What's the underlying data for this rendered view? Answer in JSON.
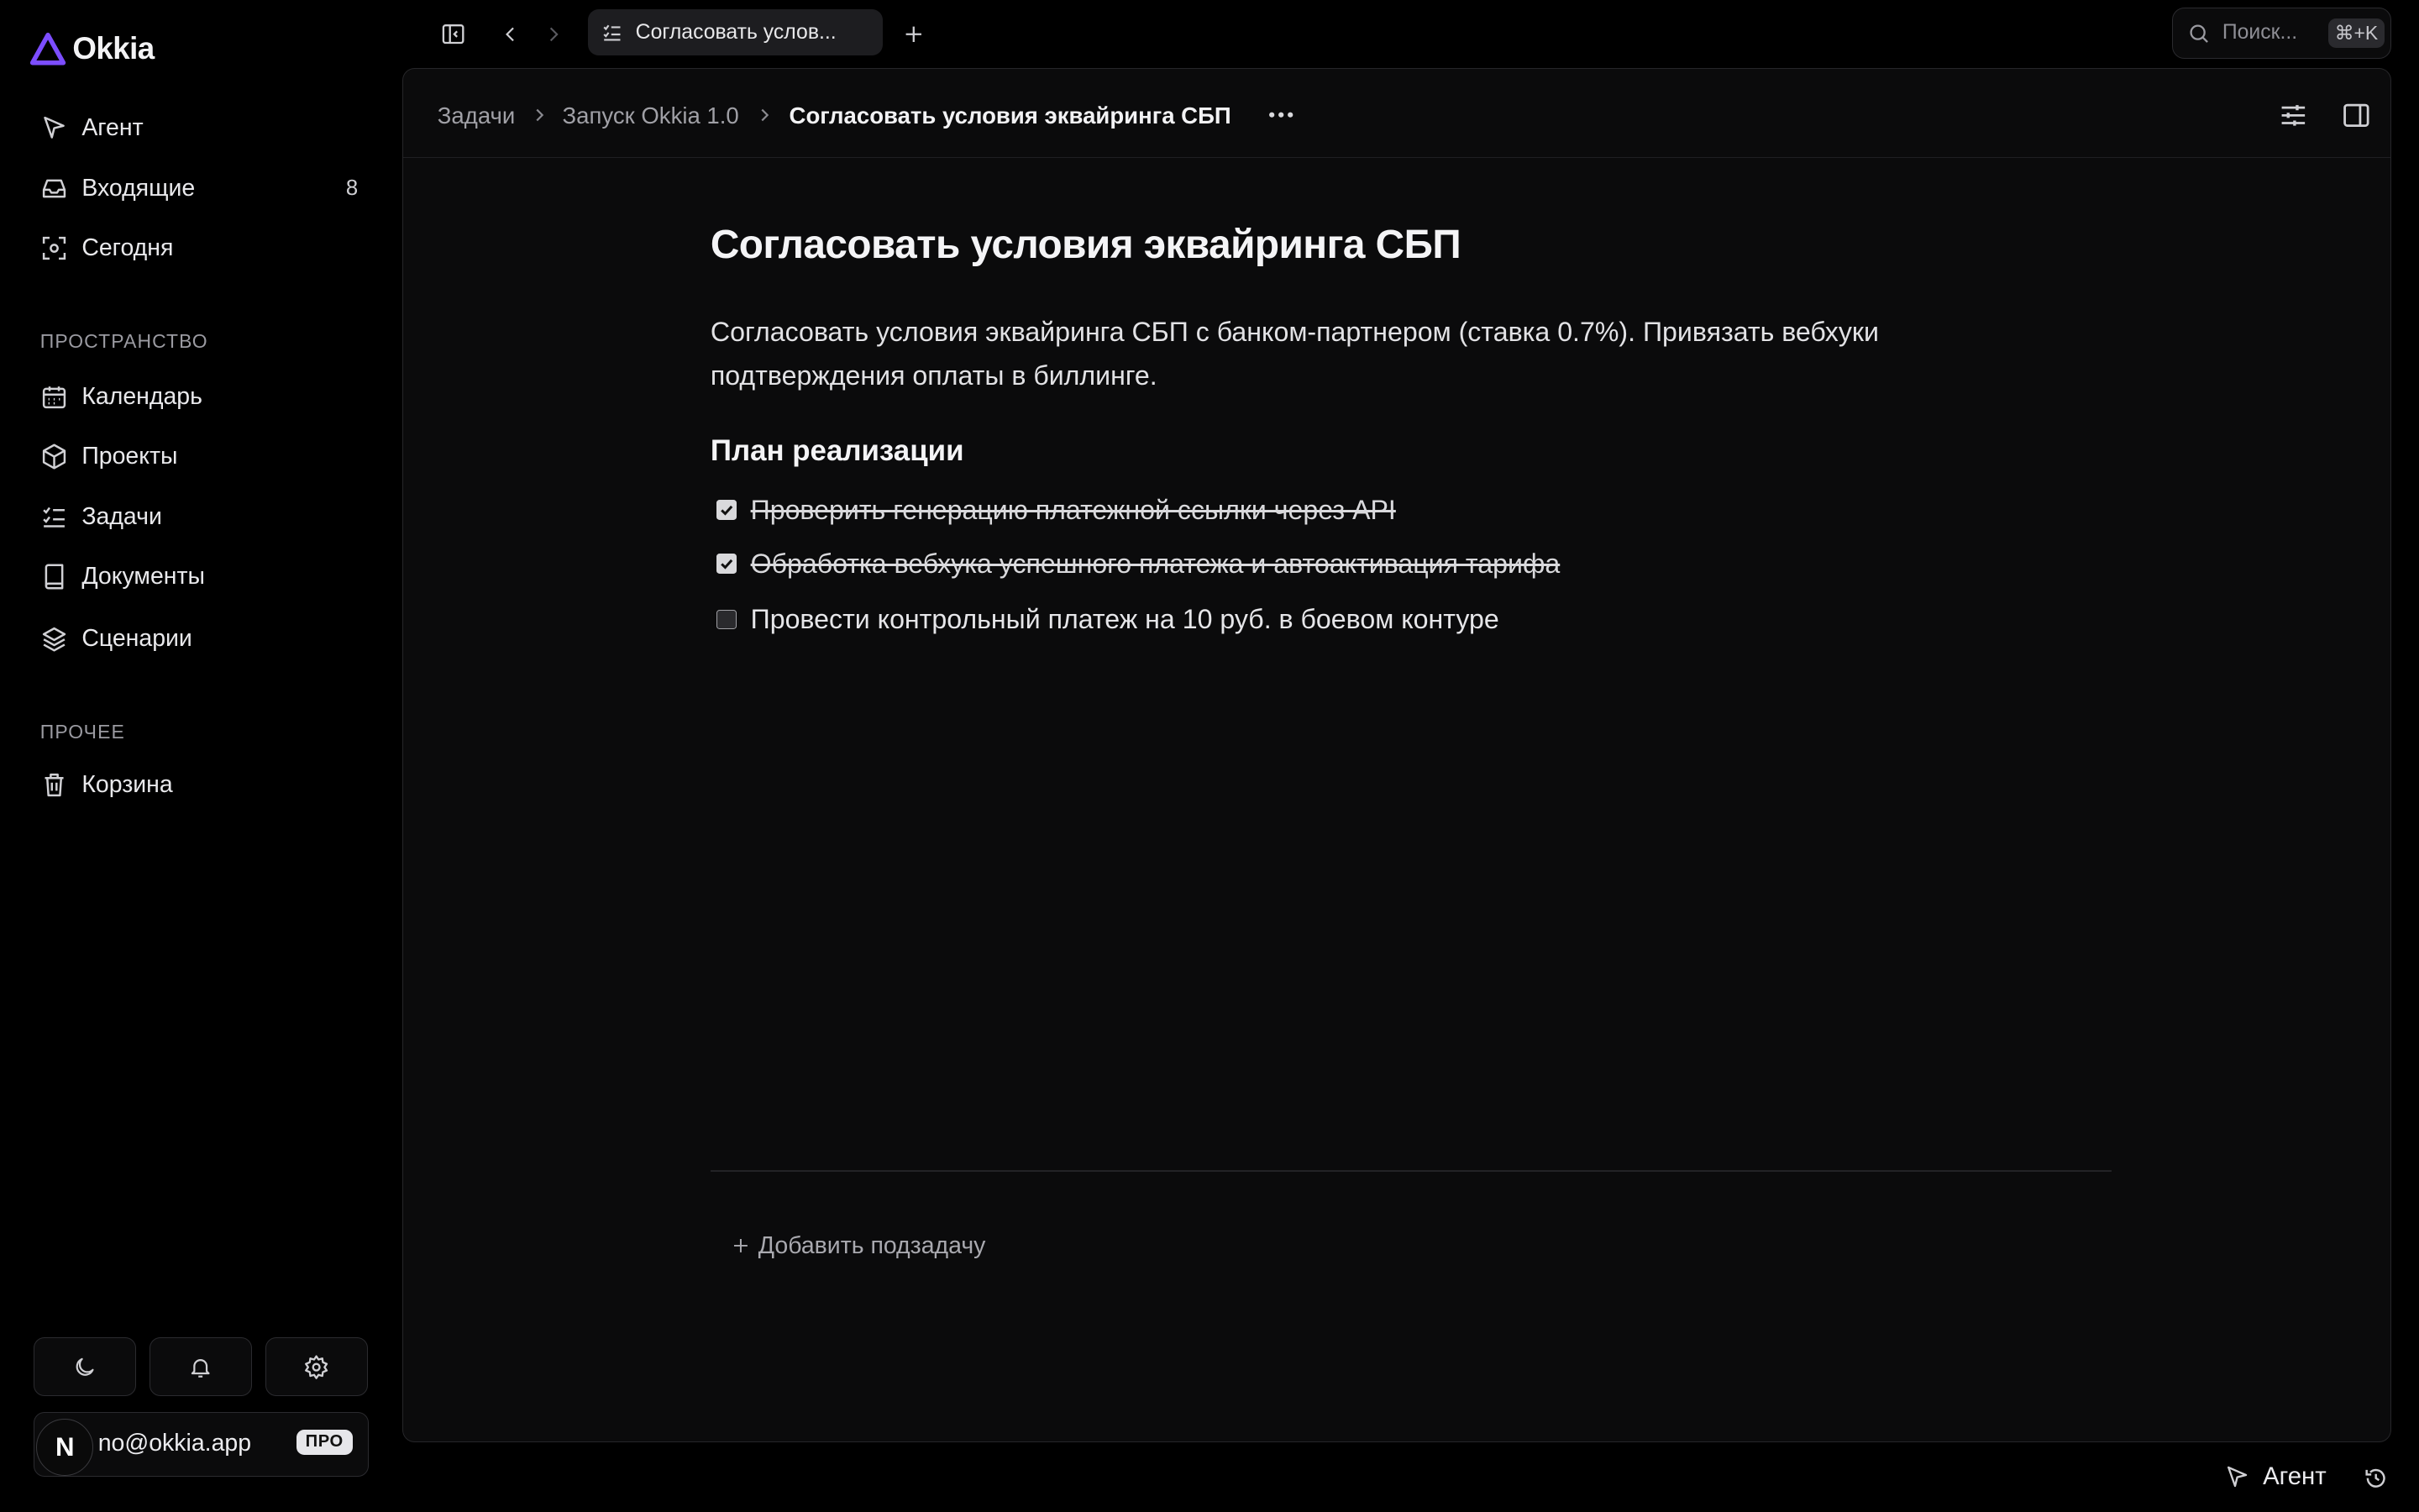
{
  "app": {
    "name": "Okkia",
    "brand_color": "#7c4dff"
  },
  "sidebar": {
    "nav": [
      {
        "label": "Агент",
        "icon": "cursor-icon"
      },
      {
        "label": "Входящие",
        "icon": "inbox-icon",
        "count": "8"
      },
      {
        "label": "Сегодня",
        "icon": "focus-icon"
      }
    ],
    "space_label": "ПРОСТРАНСТВО",
    "space": [
      {
        "label": "Календарь",
        "icon": "calendar-icon"
      },
      {
        "label": "Проекты",
        "icon": "box-icon"
      },
      {
        "label": "Задачи",
        "icon": "checklist-icon"
      },
      {
        "label": "Документы",
        "icon": "book-icon"
      },
      {
        "label": "Сценарии",
        "icon": "layers-icon"
      }
    ],
    "other_label": "ПРОЧЕЕ",
    "other": [
      {
        "label": "Корзина",
        "icon": "trash-icon"
      }
    ],
    "user": {
      "avatar_letter": "N",
      "email": "no@okkia.app",
      "plan": "ПРО"
    }
  },
  "topbar": {
    "tab_title": "Согласовать услов...",
    "search_placeholder": "Поиск...",
    "search_shortcut": "⌘+K"
  },
  "breadcrumb": {
    "items": [
      "Задачи",
      "Запуск Okkia 1.0"
    ],
    "current": "Согласовать условия эквайринга СБП"
  },
  "task": {
    "title": "Согласовать условия эквайринга СБП",
    "description": "Согласовать условия эквайринга СБП с банком-партнером (ставка 0.7%). Привязать вебхуки подтверждения оплаты в биллинге.",
    "plan_heading": "План реализации",
    "checklist": [
      {
        "text": "Проверить генерацию платежной ссылки через API",
        "done": true
      },
      {
        "text": "Обработка вебхука успешного платежа и автоактивация тарифа",
        "done": true
      },
      {
        "text": "Провести контрольный платеж на 10 руб. в боевом контуре",
        "done": false
      }
    ],
    "add_subtask_label": "Добавить подзадачу"
  },
  "bottom": {
    "agent_label": "Агент"
  }
}
